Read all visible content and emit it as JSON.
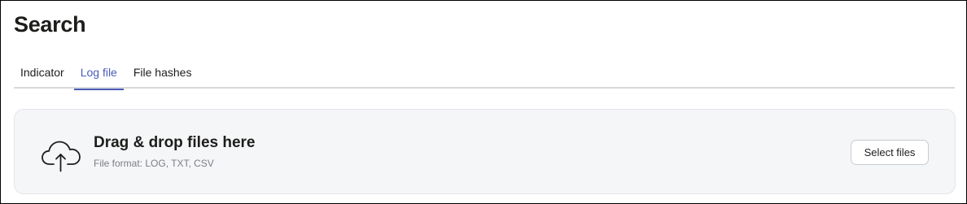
{
  "page": {
    "title": "Search"
  },
  "tabs": [
    {
      "label": "Indicator",
      "active": false
    },
    {
      "label": "Log file",
      "active": true
    },
    {
      "label": "File hashes",
      "active": false
    }
  ],
  "dropzone": {
    "icon": "cloud-upload-icon",
    "title": "Drag & drop files here",
    "subtitle": "File format: LOG, TXT, CSV",
    "button_label": "Select files"
  },
  "colors": {
    "accent": "#4a5bb8",
    "text": "#1d1d1b",
    "muted_text": "#7b7e86",
    "dropzone_bg": "#f5f6f8",
    "divider": "#d9d9dc"
  }
}
